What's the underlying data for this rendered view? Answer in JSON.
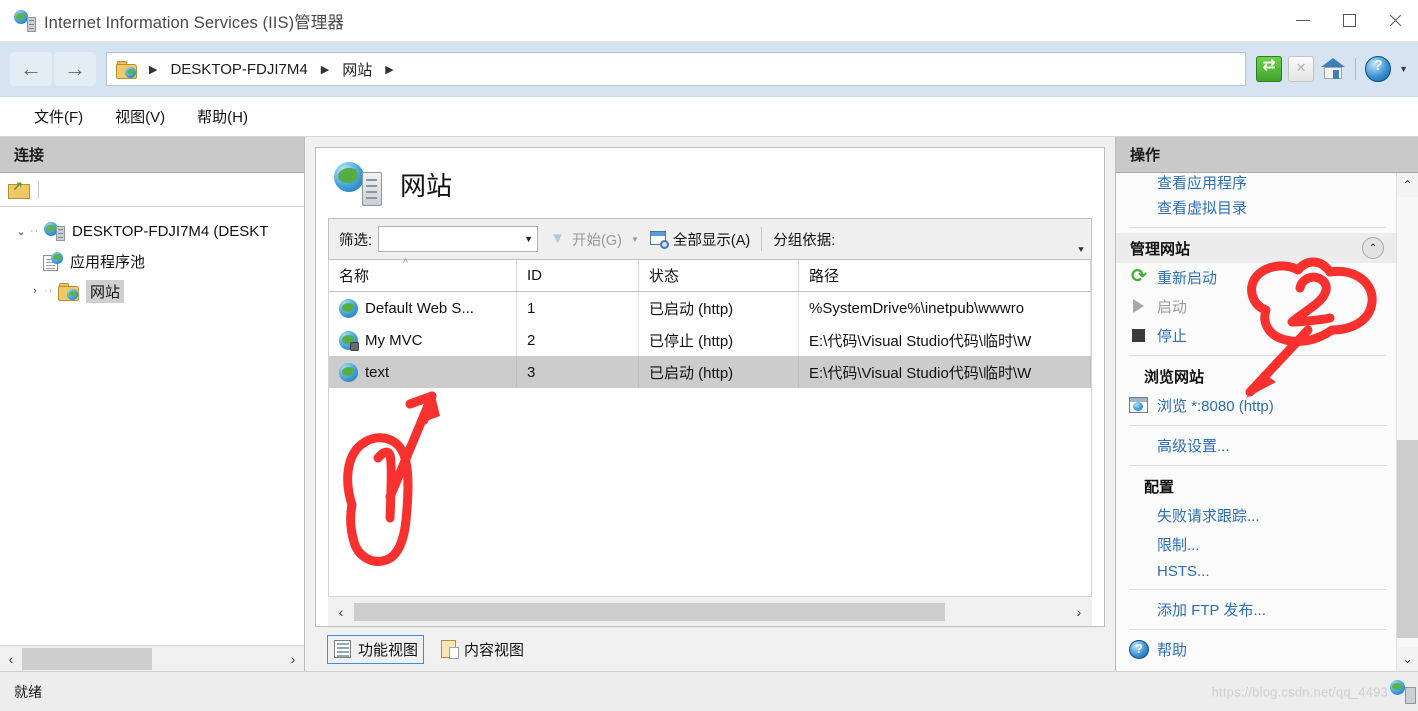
{
  "window": {
    "title": "Internet Information Services (IIS)管理器",
    "icon": "iis-server-icon",
    "controls": {
      "minimize": "—",
      "maximize": "□",
      "close": "✕"
    }
  },
  "addressbar": {
    "back_icon": "back-arrow-icon",
    "forward_icon": "forward-arrow-icon",
    "breadcrumb": [
      {
        "label": "DESKTOP-FDJI7M4"
      },
      {
        "label": "网站"
      }
    ],
    "separator": "▶",
    "toolbar_icons": [
      "refresh-icon",
      "stop-icon",
      "home-icon",
      "help-icon"
    ],
    "help_caret": "▼"
  },
  "menubar": {
    "items": [
      {
        "label": "文件(F)"
      },
      {
        "label": "视图(V)"
      },
      {
        "label": "帮助(H)"
      }
    ]
  },
  "connections": {
    "header": "连接",
    "toolbar_icon": "connect-folder-icon",
    "tree": [
      {
        "label": "DESKTOP-FDJI7M4 (DESKT",
        "icon": "server-globe-icon",
        "twisty": "⌄",
        "level": 1,
        "selected": false
      },
      {
        "label": "应用程序池",
        "icon": "app-pool-icon",
        "twisty": "",
        "level": 2,
        "selected": false
      },
      {
        "label": "网站",
        "icon": "sites-folder-icon",
        "twisty": "›",
        "level": 2,
        "selected": true
      }
    ],
    "hscroll": {
      "left": "‹",
      "right": "›"
    }
  },
  "main": {
    "page_title": "网站",
    "page_icon": "sites-big-icon",
    "filter": {
      "label": "筛选:",
      "value": "",
      "placeholder": "",
      "dropdown_caret": "▼",
      "start_label": "开始(G)",
      "start_icon": "filter-funnel-icon",
      "start_split_caret": "▼",
      "showall_label": "全部显示(A)",
      "showall_icon": "show-all-icon",
      "groupby_label": "分组依据:",
      "expand_caret": "⯆"
    },
    "grid": {
      "columns": [
        "名称",
        "ID",
        "状态",
        "路径"
      ],
      "sort_indicator": "^",
      "rows": [
        {
          "name": "Default Web S...",
          "icon": "site-globe-icon",
          "id": "1",
          "state": "已启动 (http)",
          "path": "%SystemDrive%\\inetpub\\wwwro",
          "selected": false
        },
        {
          "name": "My MVC",
          "icon": "site-globe-lock-icon",
          "id": "2",
          "state": "已停止 (http)",
          "path": "E:\\代码\\Visual Studio代码\\临时\\W",
          "selected": false
        },
        {
          "name": "text",
          "icon": "site-globe-icon",
          "id": "3",
          "state": "已启动 (http)",
          "path": "E:\\代码\\Visual Studio代码\\临时\\W",
          "selected": true
        }
      ],
      "hscroll": {
        "left": "‹",
        "right": "›"
      }
    },
    "view_tabs": [
      {
        "label": "功能视图",
        "icon": "feature-view-icon",
        "active": true
      },
      {
        "label": "内容视图",
        "icon": "content-view-icon",
        "active": false
      }
    ]
  },
  "actions": {
    "header": "操作",
    "cut_item": "查看应用程序",
    "items": [
      {
        "type": "link",
        "label": "查看虚拟目录",
        "icon": "",
        "disabled": false
      },
      {
        "type": "divider"
      },
      {
        "type": "section",
        "label": "管理网站",
        "collapse_icon": "⌃"
      },
      {
        "type": "link",
        "label": "重新启动",
        "icon": "restart-icon",
        "disabled": false
      },
      {
        "type": "link",
        "label": "启动",
        "icon": "play-icon",
        "disabled": true
      },
      {
        "type": "link",
        "label": "停止",
        "icon": "stop-square-icon",
        "disabled": false
      },
      {
        "type": "divider"
      },
      {
        "type": "subheader",
        "label": "浏览网站"
      },
      {
        "type": "link",
        "label": "浏览 *:8080 (http)",
        "icon": "browse-icon",
        "disabled": false
      },
      {
        "type": "divider"
      },
      {
        "type": "link",
        "label": "高级设置...",
        "icon": "",
        "disabled": false
      },
      {
        "type": "divider"
      },
      {
        "type": "subheader",
        "label": "配置"
      },
      {
        "type": "link",
        "label": "失败请求跟踪...",
        "icon": "",
        "disabled": false
      },
      {
        "type": "link",
        "label": "限制...",
        "icon": "",
        "disabled": false
      },
      {
        "type": "link",
        "label": "HSTS...",
        "icon": "",
        "disabled": false
      },
      {
        "type": "divider"
      },
      {
        "type": "link",
        "label": "添加 FTP 发布...",
        "icon": "",
        "disabled": false
      },
      {
        "type": "divider"
      },
      {
        "type": "link",
        "label": "帮助",
        "icon": "help-small-icon",
        "disabled": false
      }
    ],
    "scroll": {
      "up": "⌃",
      "down": "⌄"
    }
  },
  "statusbar": {
    "text": "就绪",
    "watermark": "https://blog.csdn.net/qq_4493",
    "watermark_icon": "iis-small-icon"
  },
  "annotations": {
    "color": "#f8312f",
    "marks": [
      {
        "label": "1",
        "target": "text-row"
      },
      {
        "label": "2",
        "target": "browse-8080-link"
      }
    ]
  }
}
